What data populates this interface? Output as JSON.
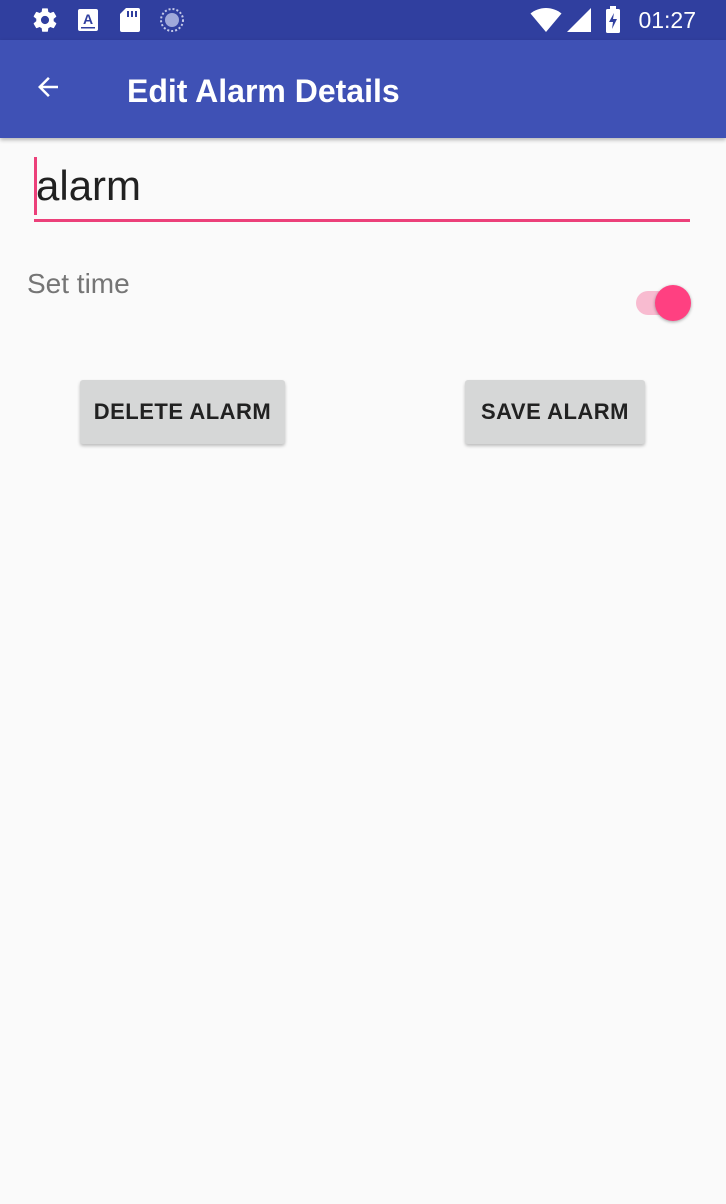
{
  "status_bar": {
    "time": "01:27",
    "left_icons": [
      "gear-icon",
      "font-a-icon",
      "sd-card-icon",
      "sync-progress-icon"
    ],
    "right_icons": [
      "wifi-icon",
      "cell-signal-icon",
      "battery-charging-icon"
    ],
    "background": "#303f9f"
  },
  "app_bar": {
    "title": "Edit Alarm Details",
    "back_icon": "arrow-back-icon",
    "background": "#3f51b5"
  },
  "form": {
    "name_value": "alarm",
    "accent_color": "#ec407a",
    "set_time_label": "Set time",
    "set_time_enabled": true
  },
  "buttons": {
    "delete_label": "DELETE ALARM",
    "save_label": "SAVE ALARM"
  }
}
